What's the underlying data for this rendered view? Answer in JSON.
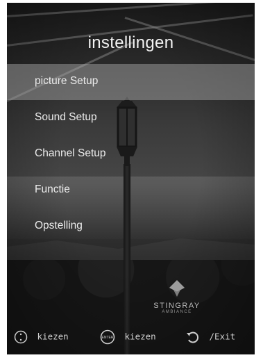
{
  "menu": {
    "title": "instellingen",
    "items": [
      {
        "label": "picture Setup",
        "selected": true
      },
      {
        "label": "Sound Setup",
        "selected": false
      },
      {
        "label": "Channel Setup",
        "selected": false
      },
      {
        "label": "Functie",
        "selected": false
      },
      {
        "label": "Opstelling",
        "selected": false
      }
    ]
  },
  "logo": {
    "name": "STINGRAY",
    "sub": "AMBIANCE"
  },
  "footer": {
    "hints": [
      {
        "icon": "dpad-icon",
        "label": "kiezen"
      },
      {
        "icon": "enter-button-icon",
        "icon_text": "ENTER",
        "label": "kiezen"
      },
      {
        "icon": "back-icon",
        "label": "/Exit"
      }
    ]
  },
  "colors": {
    "selected_highlight": "#afafaf",
    "text": "#ececec"
  }
}
